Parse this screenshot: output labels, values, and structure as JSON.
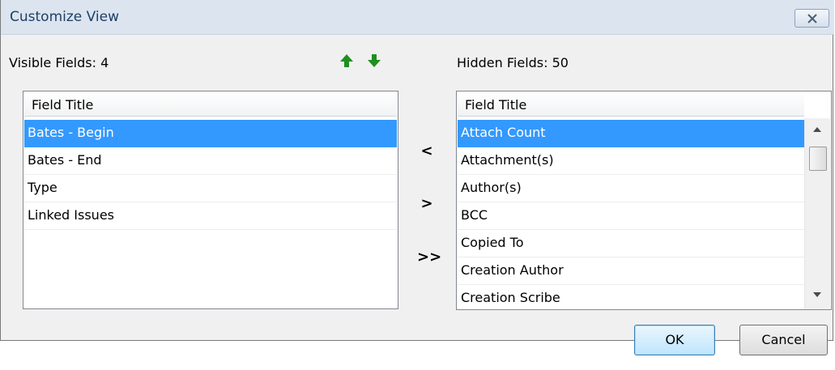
{
  "window": {
    "title": "Customize View",
    "close_icon": "close-icon"
  },
  "visible": {
    "label": "Visible Fields: 4",
    "header": "Field Title",
    "items": [
      "Bates - Begin",
      "Bates - End",
      "Type",
      "Linked Issues"
    ],
    "selected_index": 0
  },
  "hidden": {
    "label": "Hidden Fields: 50",
    "header": "Field Title",
    "items": [
      "Attach Count",
      "Attachment(s)",
      "Author(s)",
      "BCC",
      "Copied To",
      "Creation Author",
      "Creation Scribe"
    ],
    "selected_index": 0
  },
  "move": {
    "left": "<",
    "right": ">",
    "all_right": ">>"
  },
  "buttons": {
    "ok": "OK",
    "cancel": "Cancel"
  },
  "colors": {
    "selection": "#3399ff",
    "arrow_green": "#1f8f1f",
    "title_bar": "#dbe4ef"
  }
}
